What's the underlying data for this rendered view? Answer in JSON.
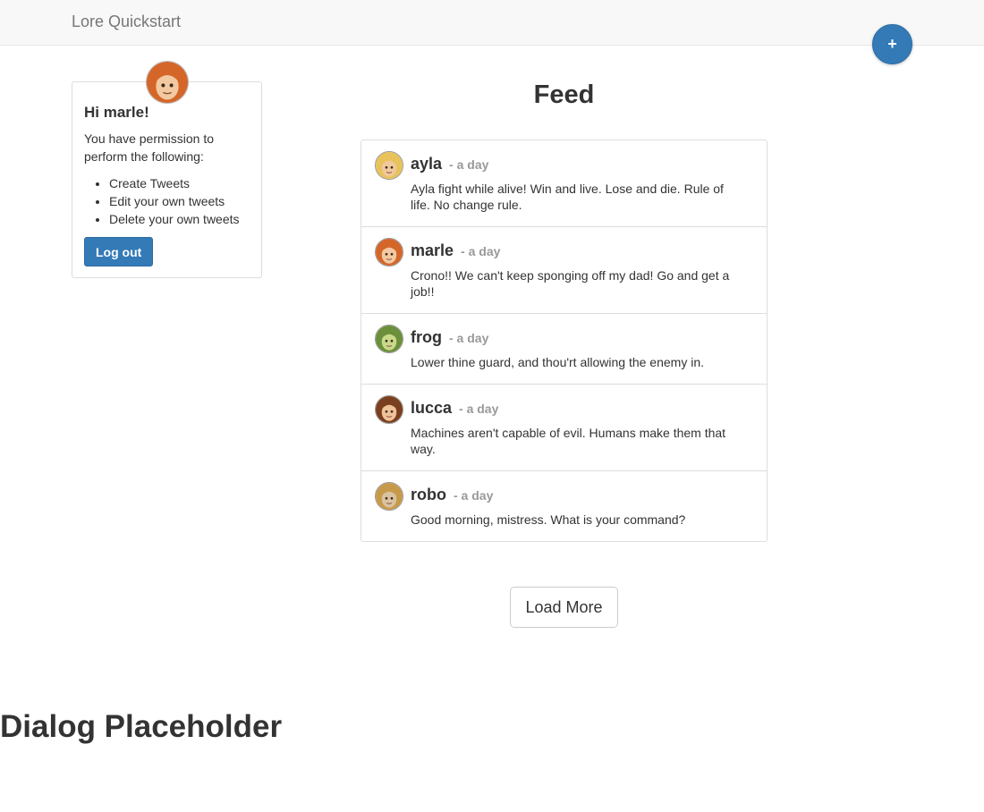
{
  "navbar": {
    "brand": "Lore Quickstart"
  },
  "fab": {
    "label": "+"
  },
  "profile": {
    "greeting": "Hi marle!",
    "intro": "You have permission to perform the following:",
    "permissions": [
      "Create Tweets",
      "Edit your own tweets",
      "Delete your own tweets"
    ],
    "logout_label": "Log out",
    "avatar": {
      "icon": "marle-avatar",
      "hair": "#d4662a",
      "skin": "#f2c9a0"
    }
  },
  "feed": {
    "title": "Feed",
    "tweets": [
      {
        "user": "ayla",
        "time": "- a day",
        "text": "Ayla fight while alive! Win and live. Lose and die. Rule of life. No change rule.",
        "avatar": {
          "icon": "ayla-avatar",
          "hair": "#e8c25a",
          "skin": "#f0c89a"
        }
      },
      {
        "user": "marle",
        "time": "- a day",
        "text": "Crono!! We can't keep sponging off my dad! Go and get a job!!",
        "avatar": {
          "icon": "marle-avatar",
          "hair": "#d4662a",
          "skin": "#f2c9a0"
        }
      },
      {
        "user": "frog",
        "time": "- a day",
        "text": "Lower thine guard, and thou'rt allowing the enemy in.",
        "avatar": {
          "icon": "frog-avatar",
          "hair": "#6b8f3a",
          "skin": "#c9d98a"
        }
      },
      {
        "user": "lucca",
        "time": "- a day",
        "text": "Machines aren't capable of evil. Humans make them that way.",
        "avatar": {
          "icon": "lucca-avatar",
          "hair": "#7a3f1e",
          "skin": "#efc39a"
        }
      },
      {
        "user": "robo",
        "time": "- a day",
        "text": "Good morning, mistress. What is your command?",
        "avatar": {
          "icon": "robo-avatar",
          "hair": "#c79a4a",
          "skin": "#d9c2a0"
        }
      }
    ]
  },
  "load_more_label": "Load More",
  "dialog_placeholder": "Dialog Placeholder"
}
